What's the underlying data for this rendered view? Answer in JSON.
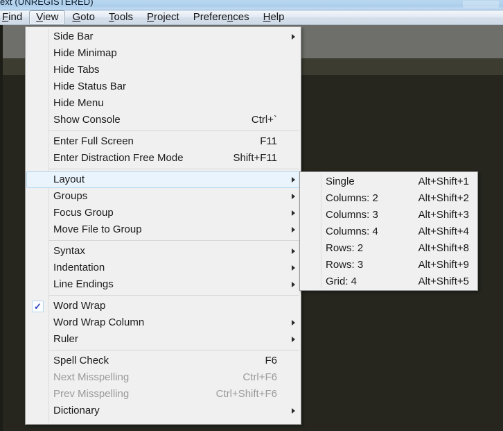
{
  "window": {
    "title": "ext (UNREGISTERED)"
  },
  "menubar": {
    "items": [
      {
        "label": "Find",
        "mnemonic": "F"
      },
      {
        "label": "View",
        "mnemonic": "V"
      },
      {
        "label": "Goto",
        "mnemonic": "G"
      },
      {
        "label": "Tools",
        "mnemonic": "T"
      },
      {
        "label": "Project",
        "mnemonic": "P"
      },
      {
        "label": "Preferences",
        "mnemonic": "n"
      },
      {
        "label": "Help",
        "mnemonic": "H"
      }
    ],
    "active": "View"
  },
  "view_menu": {
    "groups": [
      {
        "items": [
          {
            "label": "Side Bar",
            "shortcut": "",
            "submenu": true,
            "checked": false,
            "disabled": false
          },
          {
            "label": "Hide Minimap",
            "shortcut": "",
            "submenu": false,
            "checked": false,
            "disabled": false
          },
          {
            "label": "Hide Tabs",
            "shortcut": "",
            "submenu": false,
            "checked": false,
            "disabled": false
          },
          {
            "label": "Hide Status Bar",
            "shortcut": "",
            "submenu": false,
            "checked": false,
            "disabled": false
          },
          {
            "label": "Hide Menu",
            "shortcut": "",
            "submenu": false,
            "checked": false,
            "disabled": false
          },
          {
            "label": "Show Console",
            "shortcut": "Ctrl+`",
            "submenu": false,
            "checked": false,
            "disabled": false
          }
        ]
      },
      {
        "items": [
          {
            "label": "Enter Full Screen",
            "shortcut": "F11",
            "submenu": false,
            "checked": false,
            "disabled": false
          },
          {
            "label": "Enter Distraction Free Mode",
            "shortcut": "Shift+F11",
            "submenu": false,
            "checked": false,
            "disabled": false
          }
        ]
      },
      {
        "items": [
          {
            "label": "Layout",
            "shortcut": "",
            "submenu": true,
            "checked": false,
            "disabled": false,
            "selected": true
          },
          {
            "label": "Groups",
            "shortcut": "",
            "submenu": true,
            "checked": false,
            "disabled": false
          },
          {
            "label": "Focus Group",
            "shortcut": "",
            "submenu": true,
            "checked": false,
            "disabled": false
          },
          {
            "label": "Move File to Group",
            "shortcut": "",
            "submenu": true,
            "checked": false,
            "disabled": false
          }
        ]
      },
      {
        "items": [
          {
            "label": "Syntax",
            "shortcut": "",
            "submenu": true,
            "checked": false,
            "disabled": false
          },
          {
            "label": "Indentation",
            "shortcut": "",
            "submenu": true,
            "checked": false,
            "disabled": false
          },
          {
            "label": "Line Endings",
            "shortcut": "",
            "submenu": true,
            "checked": false,
            "disabled": false
          }
        ]
      },
      {
        "items": [
          {
            "label": "Word Wrap",
            "shortcut": "",
            "submenu": false,
            "checked": true,
            "disabled": false
          },
          {
            "label": "Word Wrap Column",
            "shortcut": "",
            "submenu": true,
            "checked": false,
            "disabled": false
          },
          {
            "label": "Ruler",
            "shortcut": "",
            "submenu": true,
            "checked": false,
            "disabled": false
          }
        ]
      },
      {
        "items": [
          {
            "label": "Spell Check",
            "shortcut": "F6",
            "submenu": false,
            "checked": false,
            "disabled": false
          },
          {
            "label": "Next Misspelling",
            "shortcut": "Ctrl+F6",
            "submenu": false,
            "checked": false,
            "disabled": true
          },
          {
            "label": "Prev Misspelling",
            "shortcut": "Ctrl+Shift+F6",
            "submenu": false,
            "checked": false,
            "disabled": true
          },
          {
            "label": "Dictionary",
            "shortcut": "",
            "submenu": true,
            "checked": false,
            "disabled": false
          }
        ]
      }
    ]
  },
  "layout_submenu": {
    "items": [
      {
        "label": "Single",
        "shortcut": "Alt+Shift+1"
      },
      {
        "label": "Columns: 2",
        "shortcut": "Alt+Shift+2"
      },
      {
        "label": "Columns: 3",
        "shortcut": "Alt+Shift+3"
      },
      {
        "label": "Columns: 4",
        "shortcut": "Alt+Shift+4"
      },
      {
        "label": "Rows: 2",
        "shortcut": "Alt+Shift+8"
      },
      {
        "label": "Rows: 3",
        "shortcut": "Alt+Shift+9"
      },
      {
        "label": "Grid: 4",
        "shortcut": "Alt+Shift+5"
      }
    ]
  },
  "icons": {
    "submenu_arrow": "submenu-arrow-icon",
    "check": "check-icon",
    "check_glyph": "✓"
  },
  "colors": {
    "menu_bg": "#f0f0f0",
    "menu_border": "#9a9a9a",
    "highlight_bg": "#eaf4fd",
    "highlight_border": "#b3d6f0",
    "disabled_text": "#9a9a9a",
    "editor_band_grey": "#6e6f6a",
    "editor_band_olive": "#3c3c30",
    "editor_band_dark": "#26261f",
    "titlebar": "#b2d2ee",
    "check_color": "#2a40c8"
  }
}
